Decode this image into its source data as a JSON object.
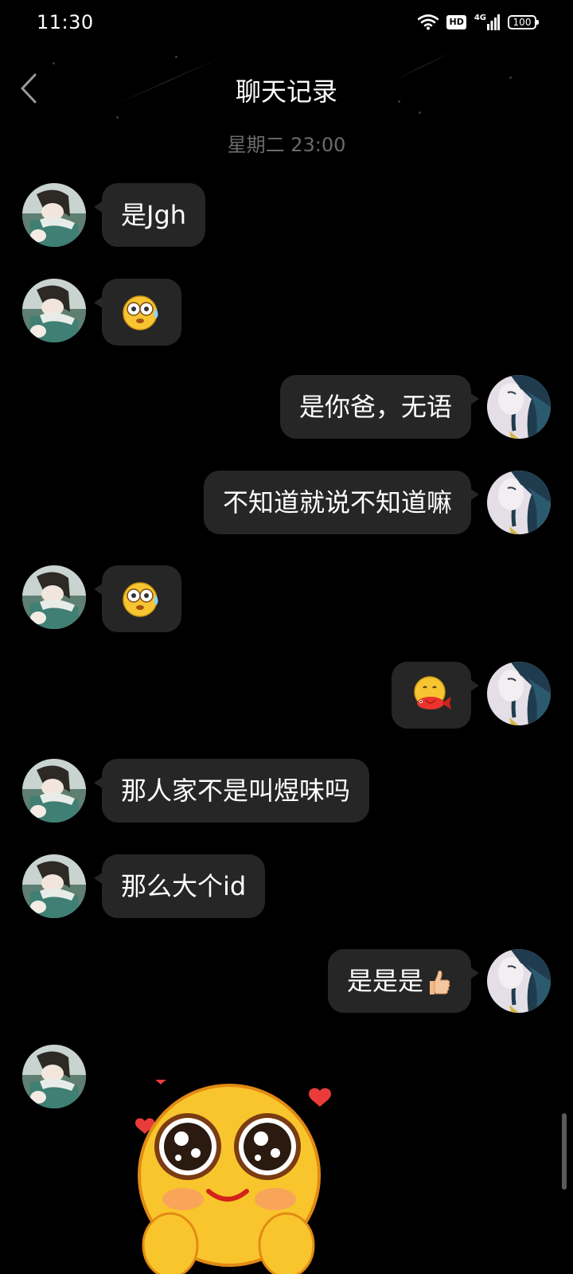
{
  "status_bar": {
    "time": "11:30",
    "hd": "HD",
    "network": "4G",
    "battery": "100"
  },
  "nav": {
    "title": "聊天记录"
  },
  "timestamp": "星期二 23:00",
  "messages": [
    {
      "side": "left",
      "type": "text",
      "text": "是Jgh"
    },
    {
      "side": "left",
      "type": "emoji",
      "emoji": "nervous-sweat-emoji"
    },
    {
      "side": "right",
      "type": "text",
      "text": "是你爸，无语"
    },
    {
      "side": "right",
      "type": "text",
      "text": "不知道就说不知道嘛"
    },
    {
      "side": "left",
      "type": "emoji",
      "emoji": "nervous-sweat-emoji"
    },
    {
      "side": "right",
      "type": "emoji",
      "emoji": "fish-eating-emoji"
    },
    {
      "side": "left",
      "type": "text",
      "text": "那人家不是叫煜味吗"
    },
    {
      "side": "left",
      "type": "text",
      "text": "那么大个id"
    },
    {
      "side": "right",
      "type": "text",
      "text": "是是是",
      "trailing_emoji": "thumbs-up-emoji"
    },
    {
      "side": "left",
      "type": "sticker",
      "sticker": "adoring-hearts-sticker"
    }
  ],
  "colors": {
    "background": "#000000",
    "bubble": "#262626",
    "timestamp": "#6b6b6b"
  }
}
